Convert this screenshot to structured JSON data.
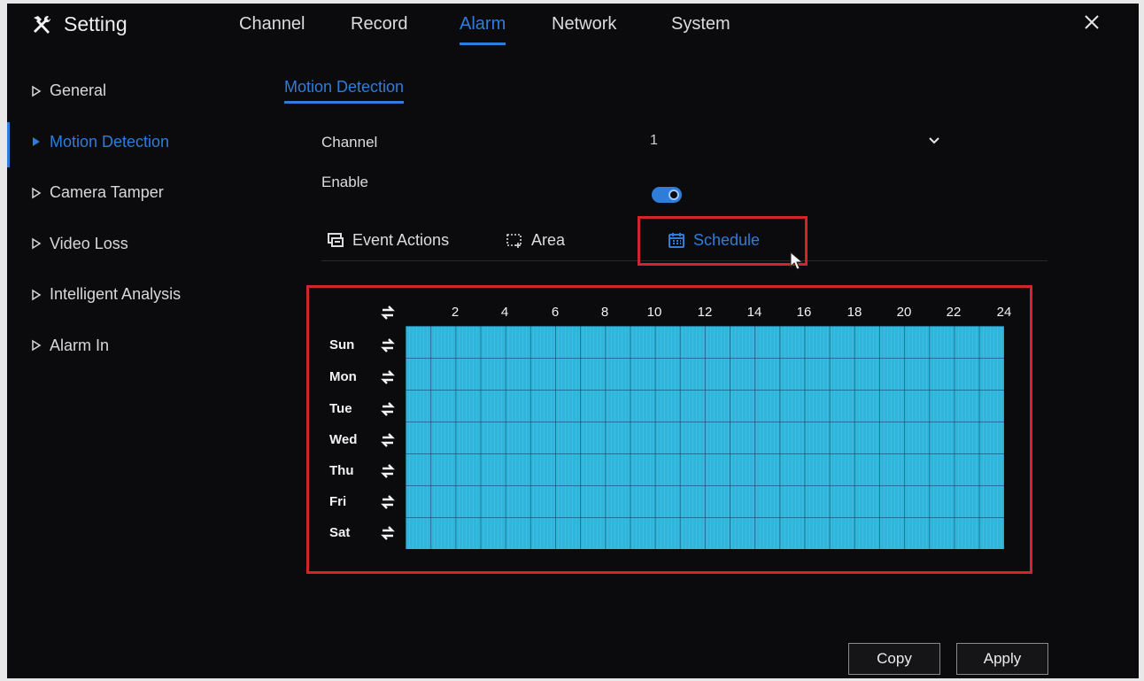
{
  "header": {
    "title": "Setting",
    "tabs": [
      "Channel",
      "Record",
      "Alarm",
      "Network",
      "System"
    ],
    "active_tab": "Alarm"
  },
  "sidebar": {
    "items": [
      "General",
      "Motion Detection",
      "Camera Tamper",
      "Video Loss",
      "Intelligent Analysis",
      "Alarm In"
    ],
    "active": "Motion Detection"
  },
  "sub_tab": "Motion Detection",
  "form": {
    "channel_label": "Channel",
    "channel_value": "1",
    "enable_label": "Enable",
    "enable_on": true
  },
  "section_tabs": [
    "Event Actions",
    "Area",
    "Schedule"
  ],
  "active_section": "Schedule",
  "schedule": {
    "hours": [
      "2",
      "4",
      "6",
      "8",
      "10",
      "12",
      "14",
      "16",
      "18",
      "20",
      "22",
      "24"
    ],
    "days": [
      "Sun",
      "Mon",
      "Tue",
      "Wed",
      "Thu",
      "Fri",
      "Sat"
    ],
    "coverage": "all days, 0-24 h enabled"
  },
  "buttons": {
    "copy": "Copy",
    "apply": "Apply"
  },
  "colors": {
    "accent": "#2f7dd8",
    "schedule_fill": "#2fb6dc",
    "highlight": "#d3242d",
    "background": "#0b0b0d"
  },
  "icons": [
    "hammer-wrench-icon",
    "close-icon",
    "triangle-right-icon",
    "chevron-down-icon",
    "event-actions-icon",
    "area-icon",
    "calendar-icon",
    "swap-icon",
    "cursor-icon"
  ]
}
